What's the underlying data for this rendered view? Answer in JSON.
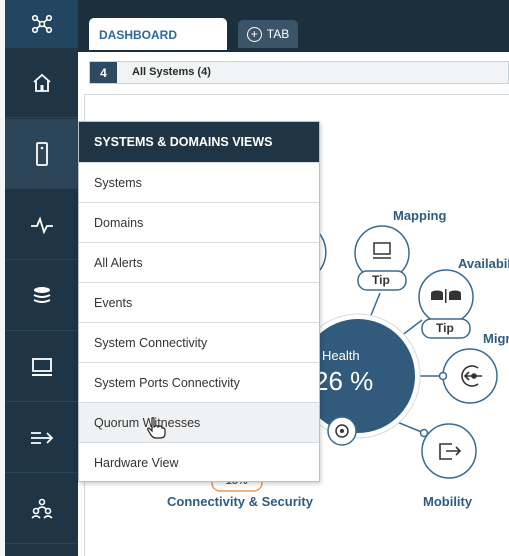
{
  "sidebar": {
    "logo_icon": "network-logo-icon",
    "items": [
      {
        "icon": "home-icon"
      },
      {
        "icon": "system-icon"
      },
      {
        "icon": "activity-icon"
      },
      {
        "icon": "storage-icon"
      },
      {
        "icon": "monitor-icon"
      },
      {
        "icon": "migrate-icon"
      },
      {
        "icon": "users-icon"
      }
    ]
  },
  "tabs": {
    "dashboard": "DASHBOARD",
    "add": "TAB"
  },
  "filter": {
    "count": "4",
    "label": "All Systems (4)"
  },
  "menu": {
    "header": "SYSTEMS & DOMAINS VIEWS",
    "items": [
      "Systems",
      "Domains",
      "All Alerts",
      "Events",
      "System Connectivity",
      "System Ports Connectivity",
      "Quorum Witnesses",
      "Hardware View"
    ]
  },
  "diagram": {
    "center_label": "Health",
    "center_value": "26 %",
    "mapping": "Mapping",
    "availability": "Availabili",
    "migration": "Migr",
    "mobility": "Mobility",
    "connectivity": "Connectivity & Security",
    "connectivity_value": "-18%",
    "tip1": "Tip",
    "tip2": "Tip"
  },
  "colors": {
    "sidebar": "#1f3444",
    "accent": "#2f5c80",
    "node_fill": "#315a7d"
  }
}
